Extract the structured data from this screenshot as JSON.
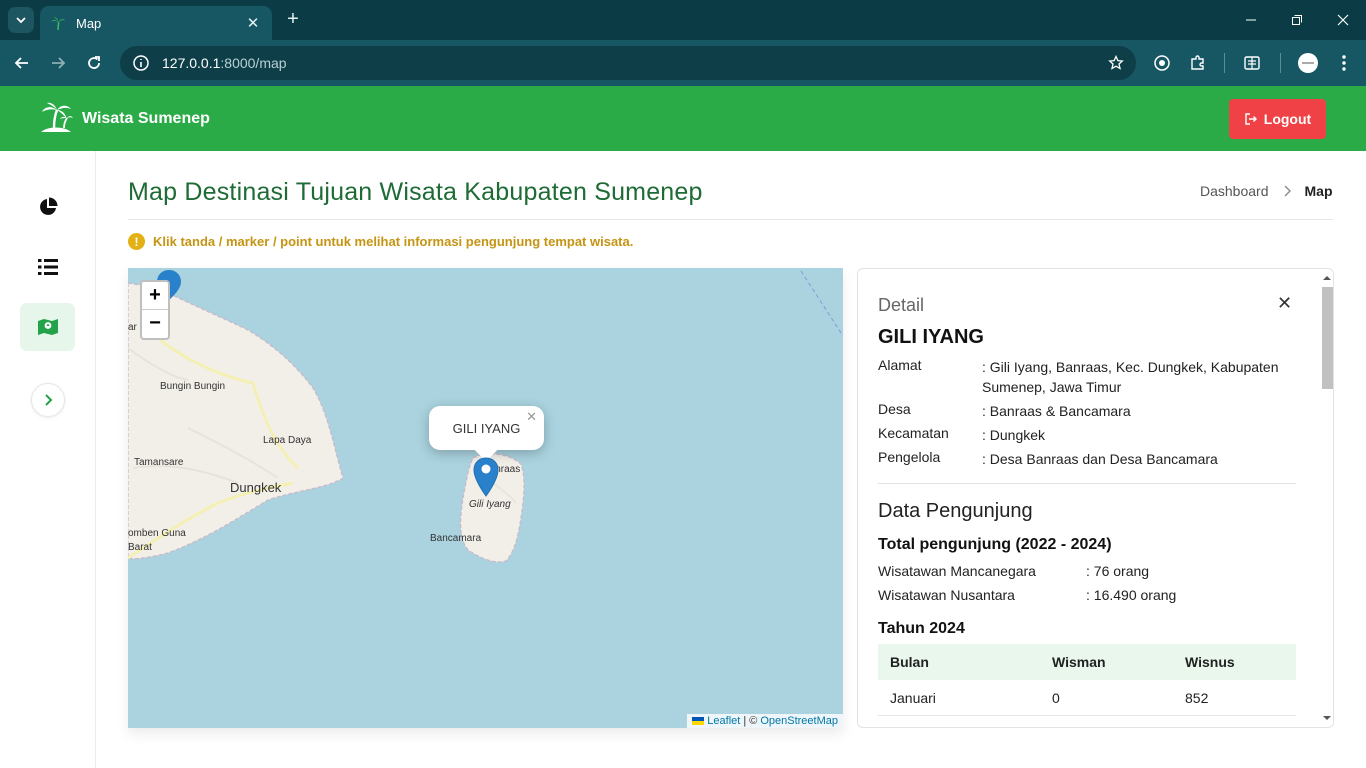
{
  "browser": {
    "tab_title": "Map",
    "url_host": "127.0.0.1",
    "url_path": ":8000/map"
  },
  "header": {
    "brand": "Wisata Sumenep",
    "logout": "Logout"
  },
  "sidebar": {
    "items": [
      {
        "icon": "pie-chart-icon"
      },
      {
        "icon": "list-icon"
      },
      {
        "icon": "map-icon",
        "active": true
      },
      {
        "icon": "chevron-right-icon"
      }
    ]
  },
  "page": {
    "title": "Map Destinasi Tujuan Wisata Kabupaten Sumenep",
    "breadcrumb": [
      "Dashboard",
      "Map"
    ],
    "notice": "Klik tanda / marker / point untuk melihat informasi pengunjung tempat wisata."
  },
  "map": {
    "labels": [
      "Bungin Bungin",
      "Lapa Daya",
      "Tamansare",
      "Dungkek",
      "Bancamara",
      "Gili Iyang",
      "Banraas",
      "omben Guna",
      "Barat",
      "ar"
    ],
    "popup": "GILI IYANG",
    "zoom_in": "+",
    "zoom_out": "−",
    "attribution_leaflet": "Leaflet",
    "attribution_sep": "| ©",
    "attribution_osm": "OpenStreetMap"
  },
  "detail": {
    "heading": "Detail",
    "name": "GILI IYANG",
    "fields": [
      {
        "label": "Alamat",
        "value": ": Gili Iyang, Banraas, Kec. Dungkek, Kabupaten Sumenep, Jawa Timur"
      },
      {
        "label": "Desa",
        "value": ": Banraas & Bancamara"
      },
      {
        "label": "Kecamatan",
        "value": ": Dungkek"
      },
      {
        "label": "Pengelola",
        "value": ": Desa Banraas dan Desa Bancamara"
      }
    ],
    "visitors_title": "Data Pengunjung",
    "total_title": "Total pengunjung (2022 - 2024)",
    "totals": [
      {
        "label": "Wisatawan Mancanegara",
        "value": ": 76 orang"
      },
      {
        "label": "Wisatawan Nusantara",
        "value": ": 16.490 orang"
      }
    ],
    "year_title": "Tahun 2024",
    "table_headers": [
      "Bulan",
      "Wisman",
      "Wisnus"
    ],
    "table_rows": [
      [
        "Januari",
        "0",
        "852"
      ]
    ]
  },
  "colors": {
    "header_green": "#2bab47",
    "title_green": "#1e6b35",
    "logout_red": "#ef4146",
    "water": "#aad3df",
    "land": "#f2efe9"
  }
}
